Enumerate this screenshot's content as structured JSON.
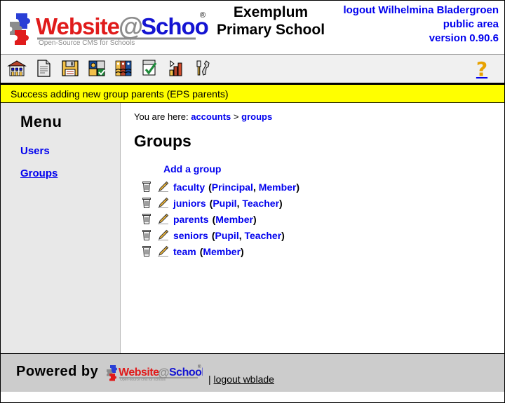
{
  "header": {
    "logo_alt": "Website@School",
    "logo_tagline": "Open-Source CMS for Schools",
    "school_name_line1": "Exemplum",
    "school_name_line2": "Primary School",
    "logout_label": "logout Wilhelmina Bladergroen",
    "area_label": "public area",
    "version_label": "version 0.90.6"
  },
  "toolbar": {
    "items": [
      {
        "icon": "school-building-icon",
        "label": "school"
      },
      {
        "icon": "page-document-icon",
        "label": "pages"
      },
      {
        "icon": "floppy-save-icon",
        "label": "save"
      },
      {
        "icon": "puzzle-modules-icon",
        "label": "modules"
      },
      {
        "icon": "users-accounts-icon",
        "label": "accounts"
      },
      {
        "icon": "checklist-approve-icon",
        "label": "tasks"
      },
      {
        "icon": "bar-chart-statistics-icon",
        "label": "statistics"
      },
      {
        "icon": "tools-wrench-icon",
        "label": "tools"
      }
    ],
    "help_label": "?",
    "help_icon": "question-mark-help-icon"
  },
  "message": {
    "text": "Success adding new group parents (EPS parents)",
    "background": "#ffff00"
  },
  "sidebar": {
    "title": "Menu",
    "items": [
      {
        "label": "Users",
        "current": false
      },
      {
        "label": "Groups",
        "current": true
      }
    ]
  },
  "main": {
    "breadcrumb_prefix": "You are here:",
    "breadcrumb": [
      {
        "label": "accounts"
      },
      {
        "label": "groups"
      }
    ],
    "breadcrumb_separator": ">",
    "page_title": "Groups",
    "add_group_label": "Add a group",
    "delete_icon": "trash-can-icon",
    "edit_icon": "pencil-edit-icon",
    "groups": [
      {
        "name": "faculty",
        "roles": [
          "Principal",
          "Member"
        ]
      },
      {
        "name": "juniors",
        "roles": [
          "Pupil",
          "Teacher"
        ]
      },
      {
        "name": "parents",
        "roles": [
          "Member"
        ]
      },
      {
        "name": "seniors",
        "roles": [
          "Pupil",
          "Teacher"
        ]
      },
      {
        "name": "team",
        "roles": [
          "Member"
        ]
      }
    ]
  },
  "footer": {
    "powered_by": "Powered by",
    "logo_alt": "Website@School",
    "separator": "|",
    "logout_label": "logout wblade"
  },
  "colors": {
    "link": "#0000ee",
    "message_bg": "#ffff00",
    "sidebar_bg": "#e8e8e8",
    "footer_bg": "#cccccc",
    "toolbar_bg": "#f0f0f0",
    "help_icon": "#e8a200"
  }
}
